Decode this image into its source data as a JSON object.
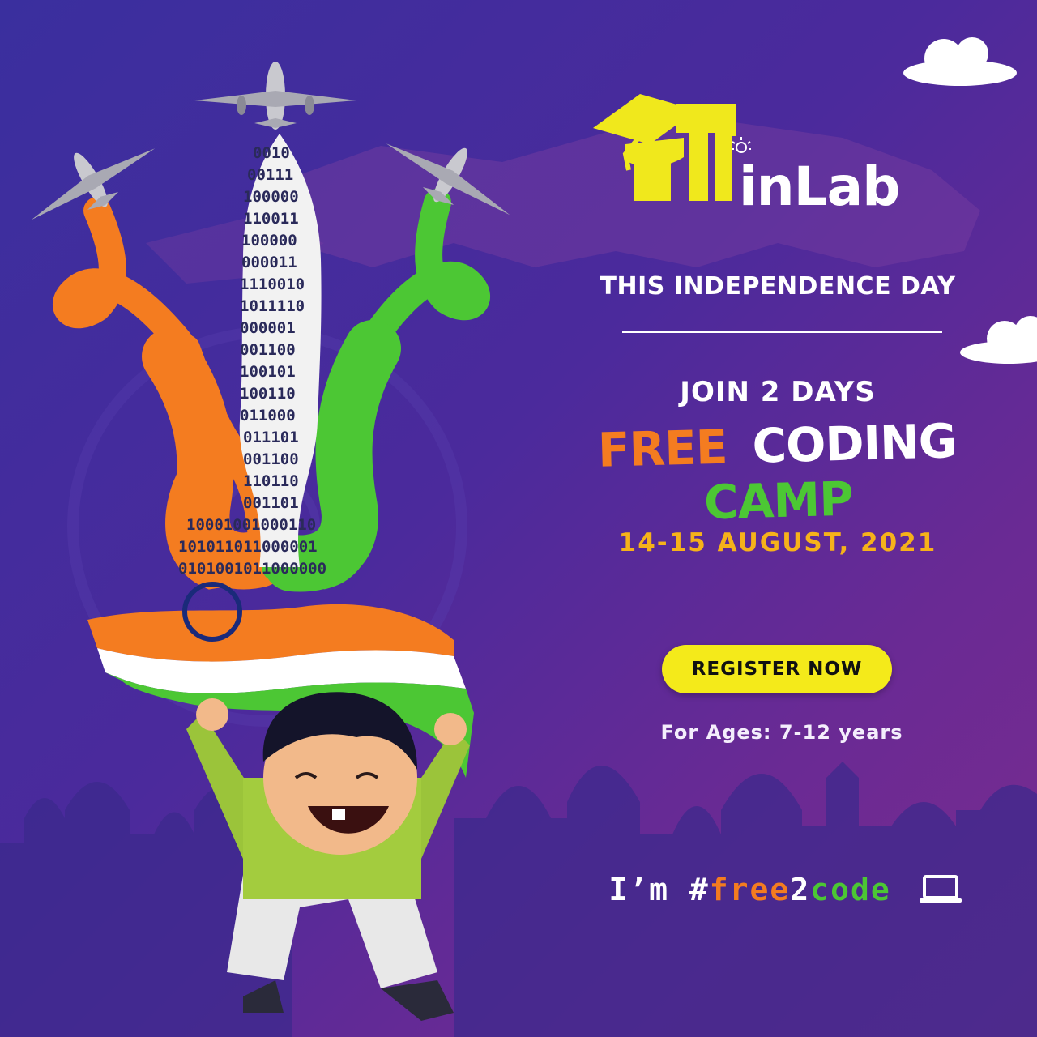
{
  "logo": {
    "word": "inLab"
  },
  "headline": {
    "occasion": "THIS INDEPENDENCE DAY",
    "join": "JOIN 2 DAYS",
    "camp_words": [
      "FREE",
      "CODING",
      "CAMP"
    ],
    "dates": "14-15  AUGUST, 2021"
  },
  "cta": {
    "register_label": "REGISTER NOW",
    "ages": "For Ages: 7-12 years"
  },
  "hashtag": {
    "prefix": "I’m ",
    "hash": "#",
    "free": "free",
    "two": "2",
    "code": "code"
  },
  "icons": [
    "graduation-cap-icon",
    "bulb-icon",
    "laptop-icon",
    "airplane-icon"
  ],
  "colors": {
    "saffron": "#f47c20",
    "green": "#4cc734",
    "date_yellow": "#f6b21a",
    "logo_yellow": "#f0e81c",
    "button_yellow": "#f4ea1a",
    "background_purple": "#4b2a9c"
  }
}
